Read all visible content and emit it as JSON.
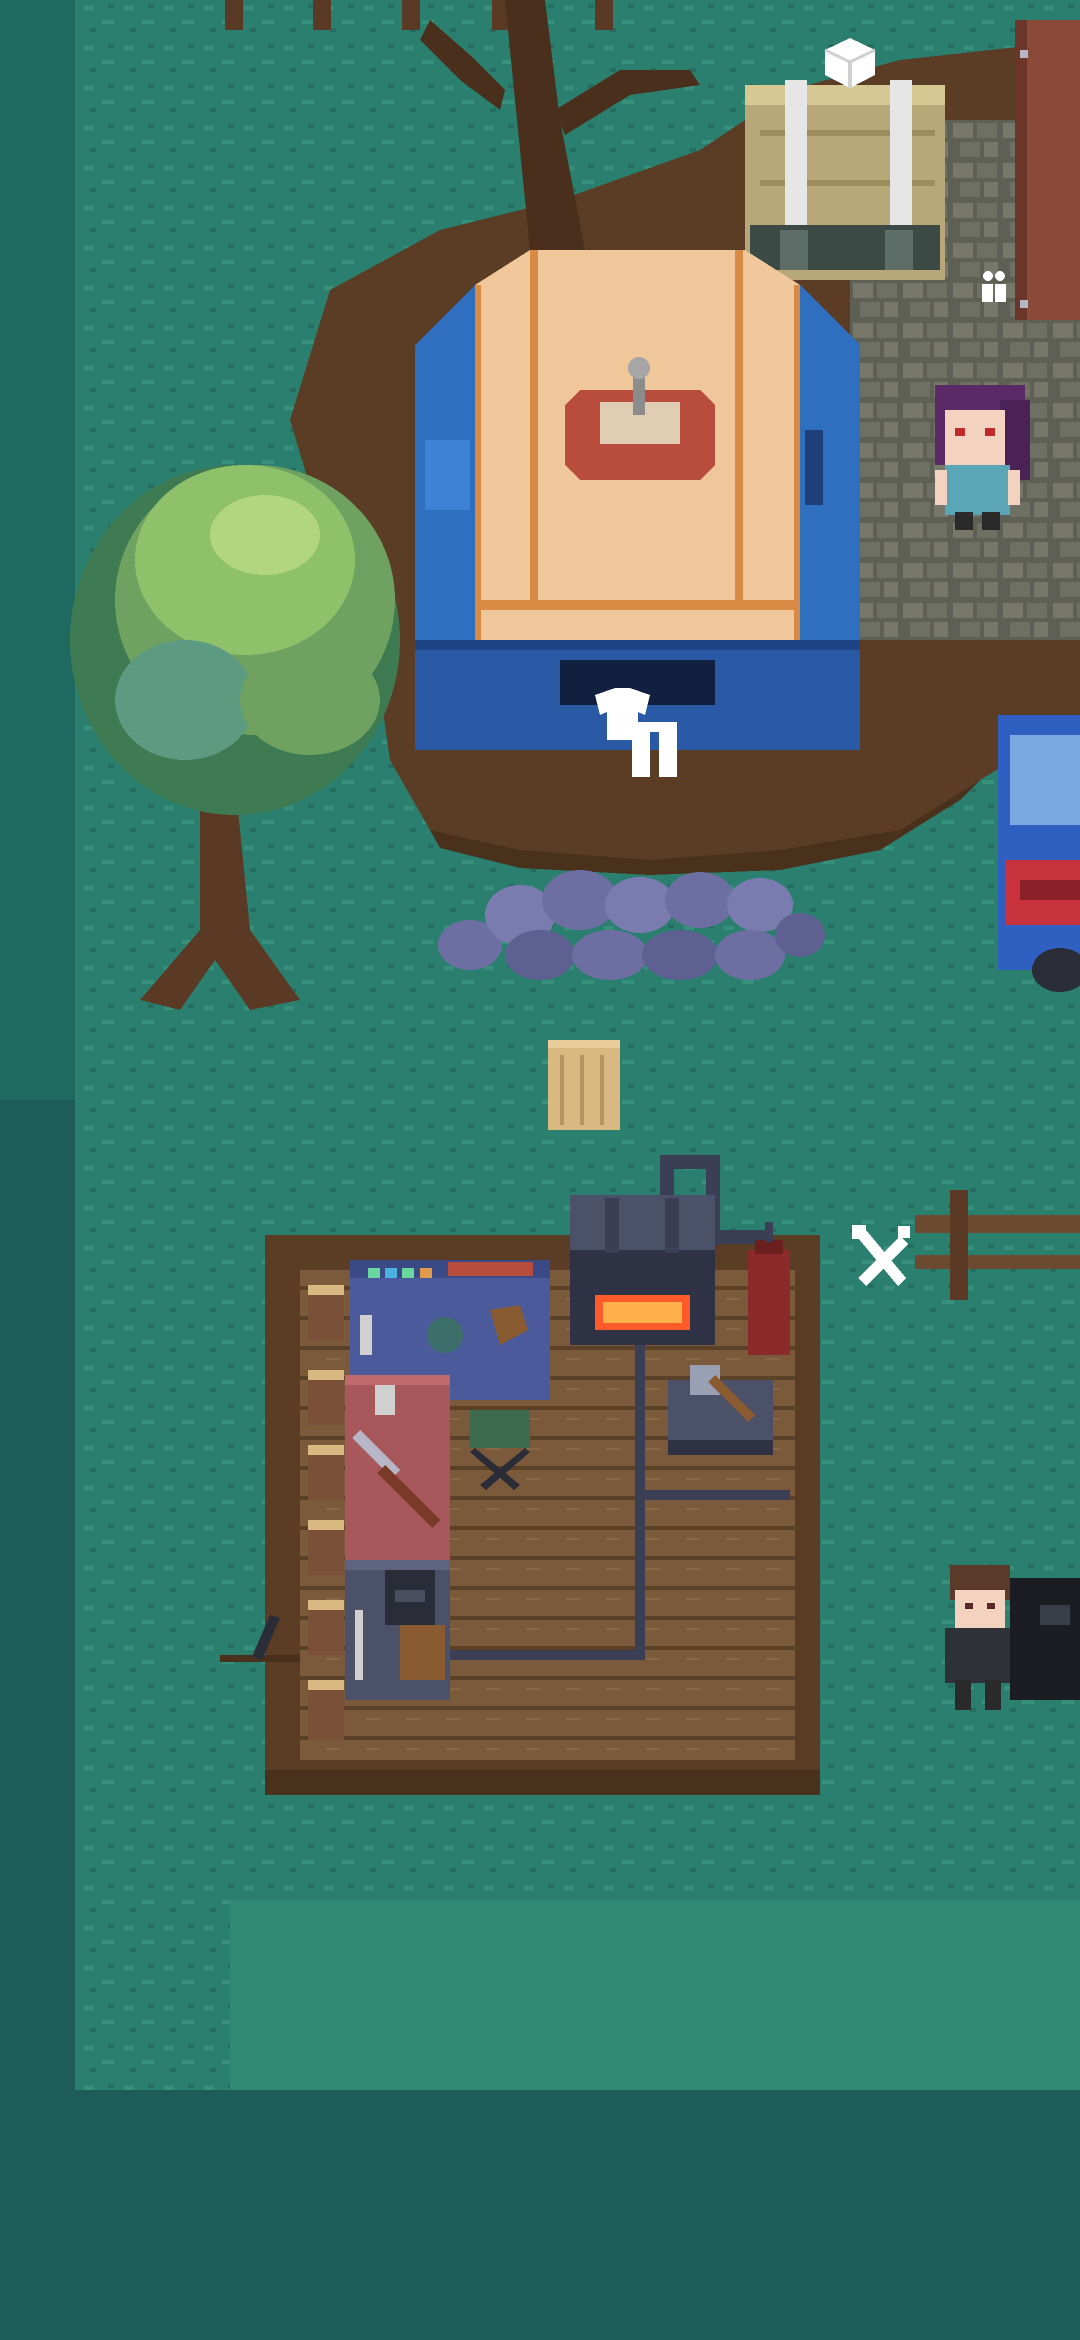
{
  "colors": {
    "deep_water": "#1d5c58",
    "forest_dark": "#1f6a60",
    "forest_mid": "#2b7f6e",
    "forest_light": "#36907b",
    "dirt": "#5a3d24",
    "dirt_dark": "#4a311c",
    "cobble": "#6f7064",
    "tent_blue": "#2f6fc0",
    "tent_tan": "#f0c79a",
    "tent_stripe": "#d98a45",
    "deck": "#7a5a3a",
    "deck_line": "#5b4128",
    "pipe": "#3a3f55",
    "rock": "#6d6fa3",
    "tree_top": "#8fc06a",
    "tree_dark": "#3e7a52",
    "trunk": "#5a3a25",
    "vehicle_blue": "#2f5fc0",
    "vehicle_red": "#c8323c"
  },
  "interactions": {
    "wardrobe": {
      "icon": "clothes-icon"
    },
    "crafting": {
      "icon": "tools-icon"
    },
    "storage": {
      "icon": "box-icon"
    },
    "npc_group": {
      "icon": "people-icon"
    }
  }
}
